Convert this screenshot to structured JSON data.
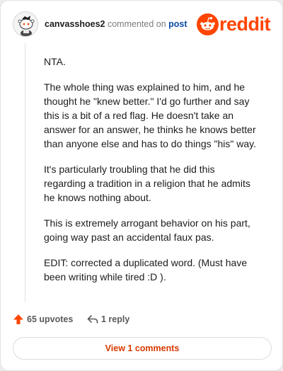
{
  "header": {
    "username": "canvasshoes2",
    "action_text": "commented on",
    "post_link": "post",
    "brand": "reddit"
  },
  "comment": {
    "paragraphs": [
      "NTA.",
      "The whole thing was explained to him, and he thought he \"knew better.\" I'd go further and say this is a bit of a red flag. He doesn't take an answer for an answer, he thinks he knows better than anyone else and has to do things \"his\" way.",
      "It's particularly troubling that he did this regarding a tradition in a religion that he admits he knows nothing about.",
      "This is extremely arrogant behavior on his part, going way past an accidental faux pas.",
      "EDIT: corrected a duplicated word. (Must have been writing while tired :D )."
    ]
  },
  "actions": {
    "upvotes_label": "65 upvotes",
    "reply_label": "1 reply"
  },
  "view_button": {
    "label": "View 1 comments"
  },
  "colors": {
    "brand": "#ff4500",
    "link": "#0a4aa6",
    "button_text": "#d93a00"
  },
  "icons": [
    "snoo-icon",
    "upvote-arrow-icon",
    "reply-arrow-icon"
  ]
}
